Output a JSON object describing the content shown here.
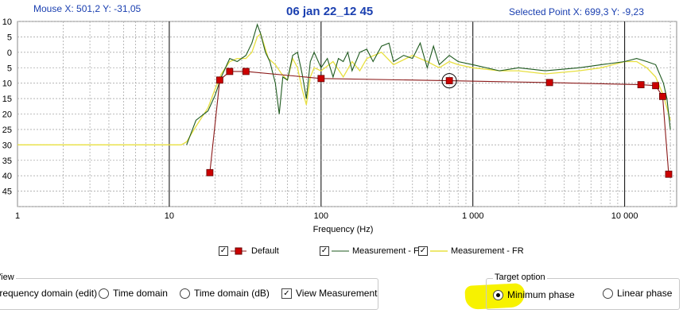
{
  "header": {
    "mouse_label": "Mouse  X: 501,2   Y: -31,05",
    "title": "06 jan 22_12 45",
    "selected_label": "Selected Point   X: 699,3   Y: -9,23"
  },
  "legend": {
    "default": "Default",
    "fl": "Measurement - FL",
    "fr": "Measurement - FR"
  },
  "view_panel": {
    "title": "View",
    "options": [
      "Frequency domain (edit)",
      "Time domain",
      "Time domain (dB)"
    ],
    "view_measurement": "View Measurement"
  },
  "target_panel": {
    "title": "Target option",
    "minimum_phase": "Minimum phase",
    "linear_phase": "Linear phase",
    "selected": "Minimum phase"
  },
  "colors": {
    "default": "#8b1a1a",
    "marker": "#cc0000",
    "fl": "#1f5a1f",
    "fr": "#e8e040",
    "accent": "#1a3fb0"
  },
  "chart_data": {
    "type": "line",
    "xlabel": "Frequency (Hz)",
    "ylabel": "",
    "x_scale": "log",
    "xlim": [
      1,
      22000
    ],
    "ylim": [
      -50,
      10
    ],
    "x_ticks": [
      "1",
      "10",
      "100",
      "1 000",
      "10 000"
    ],
    "y_ticks": [
      "10",
      "5",
      "0",
      "5",
      "10",
      "15",
      "20",
      "25",
      "30",
      "35",
      "40",
      "45"
    ],
    "grid": true,
    "selected_point": {
      "x": 699.3,
      "y": -9.23
    },
    "series": [
      {
        "name": "Default",
        "marker": "square",
        "x": [
          18.5,
          21.5,
          25,
          32,
          100,
          700,
          3200,
          12800,
          16000,
          17800,
          19500
        ],
        "y": [
          -39,
          -9,
          -6.2,
          -6.2,
          -8.5,
          -9.2,
          -9.8,
          -10.5,
          -10.8,
          -14.3,
          -39.5
        ]
      },
      {
        "name": "Measurement - FL",
        "x": [
          13,
          15,
          18,
          20,
          22,
          25,
          28,
          32,
          35,
          38,
          40,
          43,
          46,
          50,
          53,
          56,
          60,
          65,
          70,
          75,
          80,
          85,
          90,
          100,
          110,
          120,
          130,
          140,
          150,
          160,
          180,
          200,
          220,
          250,
          280,
          300,
          350,
          400,
          450,
          500,
          550,
          600,
          700,
          800,
          1000,
          1500,
          2000,
          3000,
          5000,
          7000,
          10000,
          12000,
          14000,
          16000,
          18000,
          19000,
          20000
        ],
        "y": [
          -30,
          -22,
          -19,
          -14,
          -8,
          -2,
          -3,
          -1,
          3,
          9,
          6,
          0,
          -3,
          -10,
          -20,
          -8,
          -9,
          -1,
          0,
          -7,
          -15,
          -3,
          0,
          -5,
          -2,
          -8,
          -2,
          -3,
          0,
          -6,
          0,
          1,
          -3,
          2,
          3,
          -3,
          -1,
          -2,
          3,
          -5,
          2,
          -4,
          -1,
          -3,
          -4,
          -6,
          -5,
          -6,
          -5,
          -4,
          -3,
          -2,
          -3,
          -4,
          -10,
          -15,
          -25
        ]
      },
      {
        "name": "Measurement - FR",
        "x": [
          1,
          8,
          11,
          12,
          13,
          15,
          18,
          20,
          22,
          25,
          28,
          32,
          35,
          38,
          40,
          45,
          50,
          55,
          60,
          65,
          70,
          75,
          80,
          85,
          90,
          100,
          120,
          140,
          160,
          180,
          200,
          250,
          300,
          400,
          500,
          600,
          700,
          800,
          1000,
          1500,
          2000,
          3000,
          5000,
          7000,
          10000,
          12000,
          14000,
          16000,
          18000,
          20000
        ],
        "y": [
          -30,
          -30,
          -30,
          -30,
          -29,
          -24,
          -18,
          -12,
          -7,
          -3,
          -2,
          -2,
          0,
          5,
          6,
          -2,
          -4,
          -7,
          -9,
          -2,
          -5,
          -12,
          -17,
          -8,
          -5,
          -6,
          -3,
          -8,
          -3,
          -6,
          -2,
          0,
          -4,
          -1,
          -3,
          -5,
          -3,
          -4,
          -5,
          -6,
          -6,
          -7,
          -6,
          -5,
          -3,
          -3,
          -5,
          -8,
          -14,
          -22
        ]
      }
    ]
  }
}
